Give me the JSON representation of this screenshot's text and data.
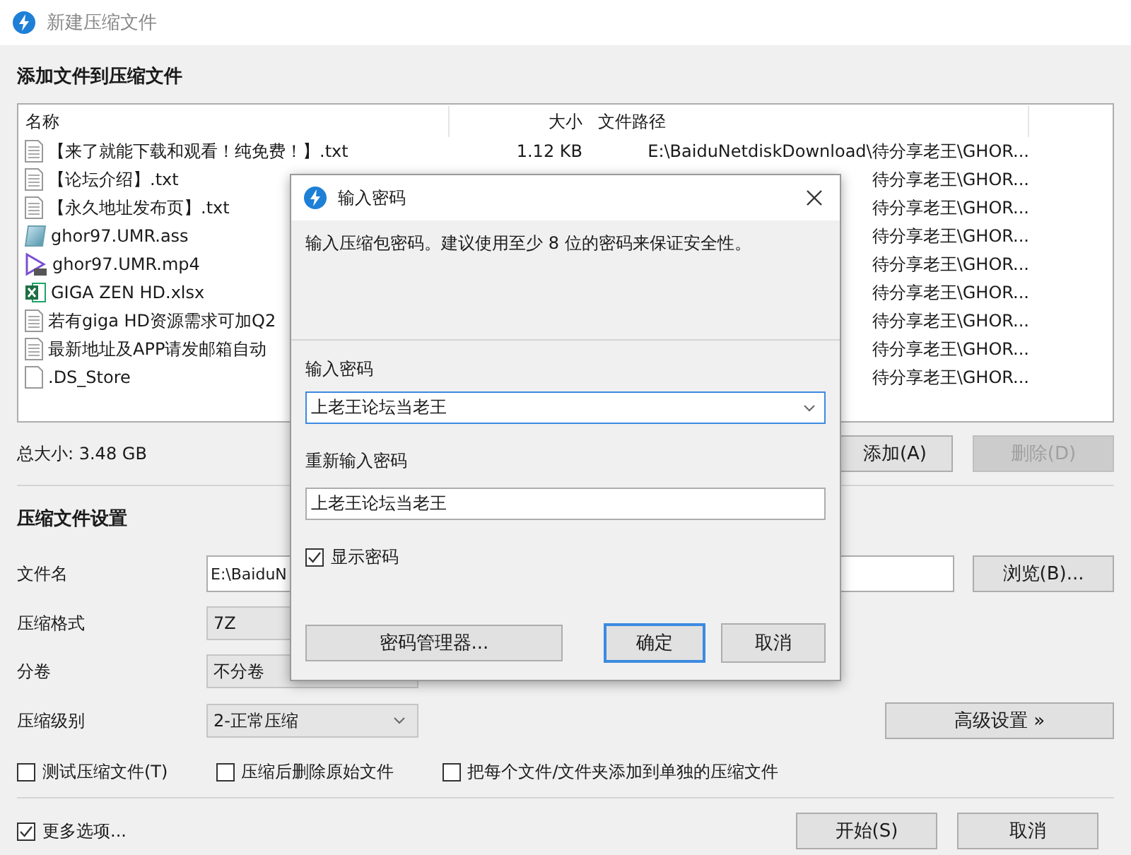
{
  "window": {
    "title": "新建压缩文件"
  },
  "files_section": {
    "heading": "添加文件到压缩文件",
    "columns": [
      {
        "label": "名称"
      },
      {
        "label": "大小"
      },
      {
        "label": "文件路径"
      }
    ],
    "rows": [
      {
        "kind": "text",
        "name": "【来了就能下载和观看！纯免费！】.txt",
        "size": "1.12 KB",
        "path": "E:\\BaiduNetdiskDownload\\待分享老王\\GHOR..."
      },
      {
        "kind": "text",
        "name": "【论坛介绍】.txt",
        "path": "待分享老王\\GHOR..."
      },
      {
        "kind": "text",
        "name": "【永久地址发布页】.txt",
        "path": "待分享老王\\GHOR..."
      },
      {
        "kind": "subtitle",
        "name": "ghor97.UMR.ass",
        "path": "待分享老王\\GHOR..."
      },
      {
        "kind": "video",
        "name": "ghor97.UMR.mp4",
        "path": "待分享老王\\GHOR..."
      },
      {
        "kind": "spreadsheet",
        "name": "GIGA ZEN HD.xlsx",
        "path": "待分享老王\\GHOR..."
      },
      {
        "kind": "text",
        "name": "若有giga HD资源需求可加Q2",
        "path": "待分享老王\\GHOR..."
      },
      {
        "kind": "text",
        "name": "最新地址及APP请发邮箱自动",
        "path": "待分享老王\\GHOR..."
      },
      {
        "kind": "blank",
        "name": ".DS_Store",
        "path": "待分享老王\\GHOR..."
      }
    ],
    "total": "总大小: 3.48 GB",
    "buttons": [
      {
        "label": "添加(A)",
        "disabled": false
      },
      {
        "label": "删除(D)",
        "disabled": true
      }
    ]
  },
  "settings": {
    "heading": "压缩文件设置",
    "filename": {
      "label": "文件名",
      "value": "E:\\BaiduN",
      "button": "浏览(B)..."
    },
    "format": {
      "label": "压缩格式",
      "value": "7Z"
    },
    "split": {
      "label": "分卷",
      "value": "不分卷"
    },
    "level": {
      "label": "压缩级别",
      "value": "2-正常压缩"
    },
    "advanced_button": "高级设置 »",
    "options": [
      {
        "label": "测试压缩文件(T)",
        "checked": false
      },
      {
        "label": "压缩后删除原始文件",
        "checked": false
      },
      {
        "label": "把每个文件/文件夹添加到单独的压缩文件",
        "checked": false
      }
    ]
  },
  "footer": {
    "more_options": {
      "label": "更多选项...",
      "checked": true
    },
    "buttons": [
      {
        "label": "开始(S)"
      },
      {
        "label": "取消"
      }
    ]
  },
  "dialog": {
    "title": "输入密码",
    "description": "输入压缩包密码。建议使用至少 8 位的密码来保证安全性。",
    "password_label": "输入密码",
    "password": "上老王论坛当老王",
    "confirm_label": "重新输入密码",
    "confirm": "上老王论坛当老王",
    "show_password": {
      "label": "显示密码",
      "checked": true
    },
    "buttons": [
      {
        "label": "密码管理器...",
        "default": false
      },
      {
        "label": "确定",
        "default": true
      },
      {
        "label": "取消",
        "default": false
      }
    ]
  }
}
